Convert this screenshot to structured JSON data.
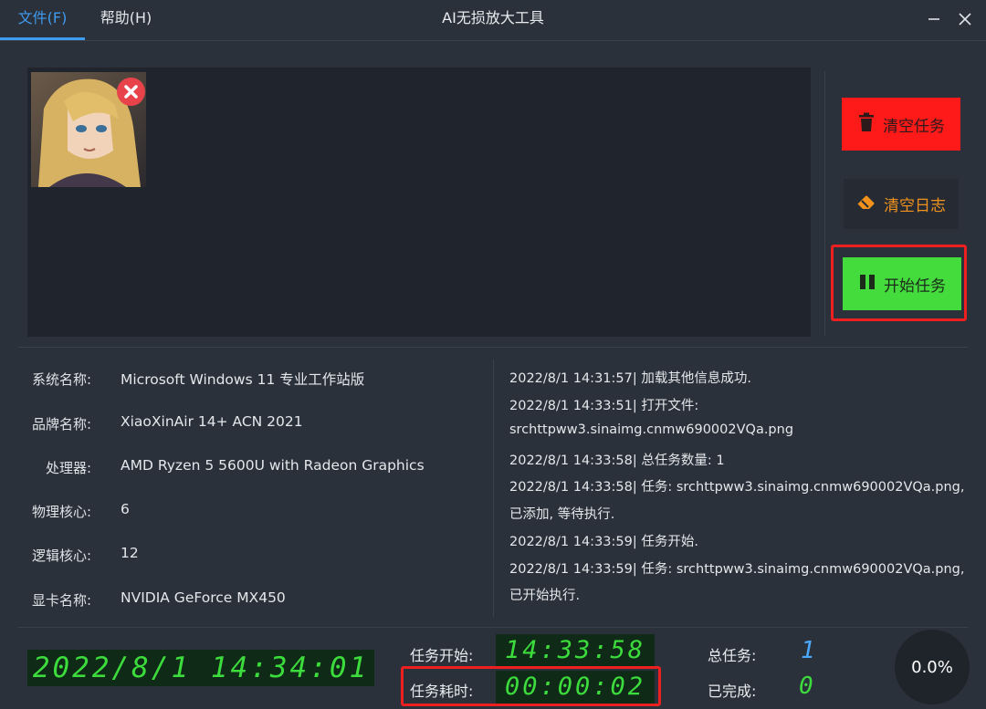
{
  "menu": {
    "file": "文件(F)",
    "help": "帮助(H)"
  },
  "window": {
    "title": "AI无损放大工具",
    "minimize_icon": "minimize-icon",
    "close_icon": "close-icon"
  },
  "actions": {
    "clear_tasks": "清空任务",
    "clear_log": "清空日志",
    "start": "开始任务"
  },
  "system_info": [
    {
      "label": "系统名称:",
      "value": "Microsoft Windows 11 专业工作站版"
    },
    {
      "label": "品牌名称:",
      "value": "XiaoXinAir 14+ ACN 2021"
    },
    {
      "label": "处理器:",
      "value": "AMD Ryzen 5 5600U with Radeon Graphics"
    },
    {
      "label": "物理核心:",
      "value": "6"
    },
    {
      "label": "逻辑核心:",
      "value": "12"
    },
    {
      "label": "显卡名称:",
      "value": "NVIDIA GeForce MX450"
    }
  ],
  "log": [
    "2022/8/1 14:31:57| 加载其他信息成功.",
    "2022/8/1 14:33:51| 打开文件:",
    "srchttpww3.sinaimg.cnmw690002VQa.png",
    "2022/8/1 14:33:58| 总任务数量: 1",
    "2022/8/1 14:33:58| 任务: srchttpww3.sinaimg.cnmw690002VQa.png,",
    "已添加, 等待执行.",
    "2022/8/1 14:33:59| 任务开始.",
    "2022/8/1 14:33:59| 任务: srchttpww3.sinaimg.cnmw690002VQa.png,",
    "已开始执行."
  ],
  "footer": {
    "clock": "2022/8/1 14:34:01",
    "task_start_label": "任务开始:",
    "task_start_value": "14:33:58",
    "elapsed_label": "任务耗时:",
    "elapsed_value": "00:00:02",
    "total_label": "总任务:",
    "total_value": "1",
    "done_label": "已完成:",
    "done_value": "0",
    "progress": "0.0%"
  },
  "colors": {
    "accent": "#3f9bf0",
    "danger": "#ff1a1a",
    "warning": "#f2921c",
    "success": "#44dc3c",
    "highlight": "#ee1f1f",
    "led_green": "#3ddc3d",
    "led_blue": "#4aa8ff"
  }
}
